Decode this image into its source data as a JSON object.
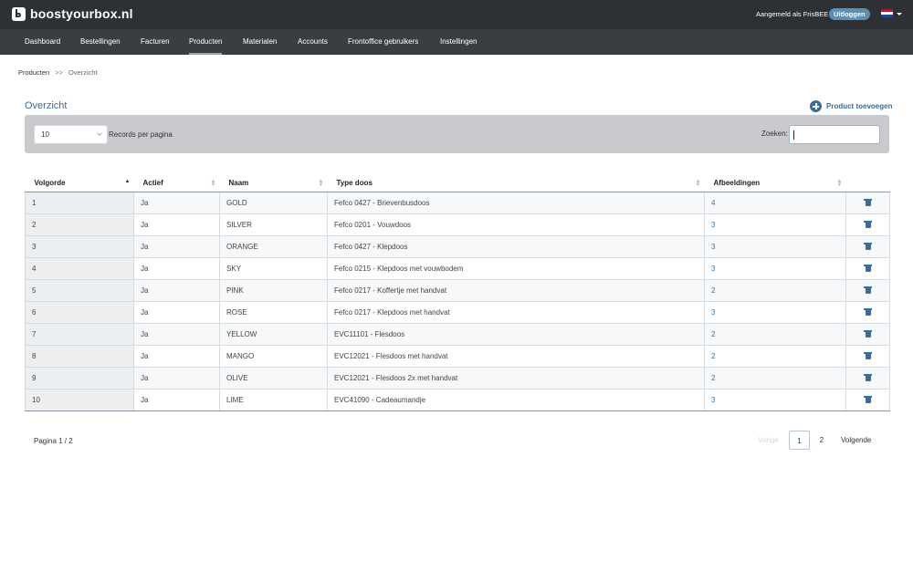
{
  "app": {
    "logo_text": "boostyourbox.nl",
    "logged_in_text": "Aangemeld als FrisBEE",
    "logout_label": "Uitloggen"
  },
  "colors": {
    "topbar": "#2d3034",
    "navbar": "#3a3e43",
    "accent": "#3d6d96",
    "badge": "#5d8eb5",
    "filter_bar": "#c8cacd"
  },
  "nav": {
    "items": [
      {
        "label": "Dashboard"
      },
      {
        "label": "Bestellingen"
      },
      {
        "label": "Facturen"
      },
      {
        "label": "Producten",
        "active": true
      },
      {
        "label": "Materialen"
      },
      {
        "label": "Accounts"
      },
      {
        "label": "Frontoffice gebruikers"
      },
      {
        "label": "Instellingen"
      }
    ]
  },
  "breadcrumb": {
    "root": "Producten",
    "separator": ">>",
    "current": "Overzicht"
  },
  "page": {
    "title": "Overzicht",
    "add_button": "Product toevoegen"
  },
  "filters": {
    "page_size": "10",
    "page_size_label": "Records per pagina",
    "search_label": "Zoeken:",
    "search_value": ""
  },
  "table": {
    "headers": [
      "Volgorde",
      "Actief",
      "Naam",
      "Type doos",
      "Afbeeldingen",
      ""
    ],
    "rows": [
      {
        "order": "1",
        "active": "Ja",
        "name": "GOLD",
        "box_type": "Fefco 0427 - Brievenbusdoos",
        "images": "4"
      },
      {
        "order": "2",
        "active": "Ja",
        "name": "SILVER",
        "box_type": "Fefco 0201 - Vouwdoos",
        "images": "3"
      },
      {
        "order": "3",
        "active": "Ja",
        "name": "ORANGE",
        "box_type": "Fefco 0427 - Klepdoos",
        "images": "3"
      },
      {
        "order": "4",
        "active": "Ja",
        "name": "SKY",
        "box_type": "Fefco 0215 - Klepdoos met vouwbodem",
        "images": "3"
      },
      {
        "order": "5",
        "active": "Ja",
        "name": "PINK",
        "box_type": "Fefco 0217 - Koffertje met handvat",
        "images": "2"
      },
      {
        "order": "6",
        "active": "Ja",
        "name": "ROSE",
        "box_type": "Fefco 0217 - Klepdoos met handvat",
        "images": "3"
      },
      {
        "order": "7",
        "active": "Ja",
        "name": "YELLOW",
        "box_type": "EVC11101 - Flesdoos",
        "images": "2"
      },
      {
        "order": "8",
        "active": "Ja",
        "name": "MANGO",
        "box_type": "EVC12021 - Flesdoos met handvat",
        "images": "2"
      },
      {
        "order": "9",
        "active": "Ja",
        "name": "OLIVE",
        "box_type": "EVC12021 - Flesdoos 2x met handvat",
        "images": "2"
      },
      {
        "order": "10",
        "active": "Ja",
        "name": "LIME",
        "box_type": "EVC41090 - Cadeaumandje",
        "images": "3"
      }
    ]
  },
  "pagination": {
    "info": "Pagina 1 / 2",
    "prev": "Vorige",
    "pages": [
      "1",
      "2"
    ],
    "next": "Volgende"
  }
}
